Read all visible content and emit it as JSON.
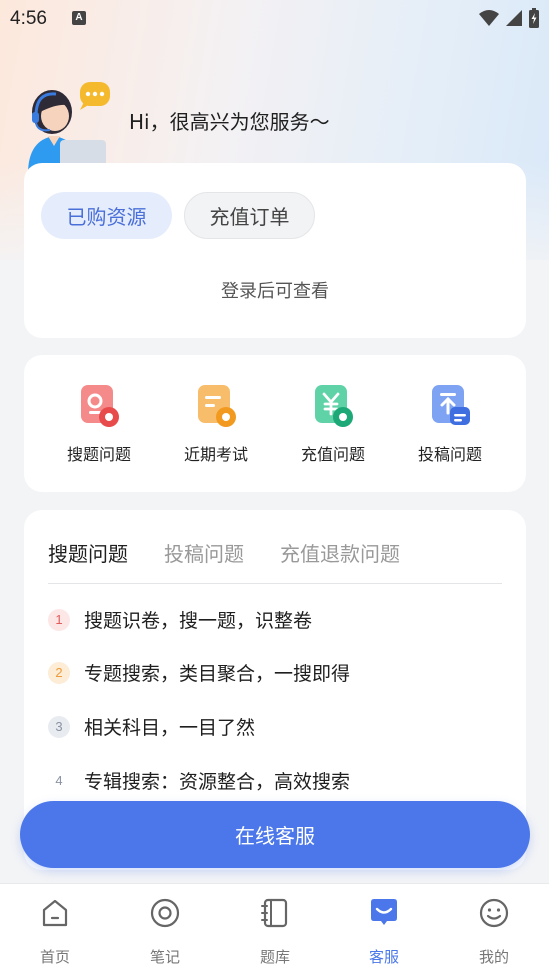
{
  "status_bar": {
    "time": "4:56",
    "notification_letter": "A"
  },
  "greeting": {
    "text": "Hi，很高兴为您服务～"
  },
  "resources": {
    "tabs": [
      "已购资源",
      "充值订单"
    ],
    "active_tab": "已购资源",
    "empty_hint": "登录后可查看"
  },
  "quick_actions": [
    {
      "label": "搜题问题",
      "icon": "search-question-icon",
      "color": "#ef5b5b"
    },
    {
      "label": "近期考试",
      "icon": "exam-icon",
      "color": "#f5a23a"
    },
    {
      "label": "充值问题",
      "icon": "yuan-recharge-icon",
      "color": "#2bbf8a"
    },
    {
      "label": "投稿问题",
      "icon": "upload-icon",
      "color": "#4b77ea"
    }
  ],
  "faq": {
    "tabs": [
      "搜题问题",
      "投稿问题",
      "充值退款问题"
    ],
    "active_tab": "搜题问题",
    "items": [
      {
        "num": "1",
        "text": "搜题识卷，搜一题，识整卷"
      },
      {
        "num": "2",
        "text": "专题搜索，类目聚合，一搜即得"
      },
      {
        "num": "3",
        "text": "相关科目，一目了然"
      },
      {
        "num": "4",
        "text": "专辑搜索：资源整合，高效搜索"
      }
    ]
  },
  "service_button": {
    "label": "在线客服"
  },
  "bottom_nav": [
    {
      "label": "首页",
      "icon": "home-icon"
    },
    {
      "label": "笔记",
      "icon": "notes-icon"
    },
    {
      "label": "题库",
      "icon": "question-bank-icon"
    },
    {
      "label": "客服",
      "icon": "customer-service-icon"
    },
    {
      "label": "我的",
      "icon": "profile-icon"
    }
  ],
  "active_nav": "客服",
  "colors": {
    "accent": "#4b77ea",
    "pill_active_bg": "#e5edfc"
  }
}
